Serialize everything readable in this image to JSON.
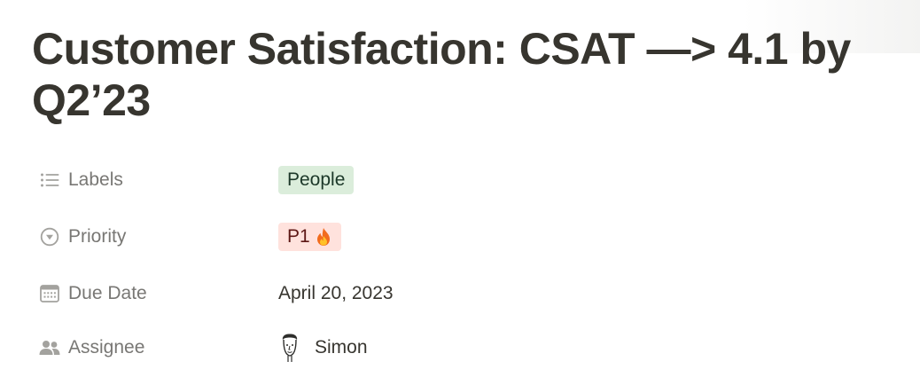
{
  "page": {
    "title": "Customer Satisfaction: CSAT —> 4.1 by Q2’23"
  },
  "properties": [
    {
      "name": "Labels",
      "icon": "list-icon",
      "value": "People",
      "color": "#dbeddb"
    },
    {
      "name": "Priority",
      "icon": "select-icon",
      "value": "P1",
      "emoji": "fire-emoji",
      "color": "#ffe2dd"
    },
    {
      "name": "Due Date",
      "icon": "calendar-icon",
      "value": "April 20, 2023"
    },
    {
      "name": "Assignee",
      "icon": "people-icon",
      "value": "Simon",
      "avatar": "avatar-sketch-icon"
    }
  ]
}
